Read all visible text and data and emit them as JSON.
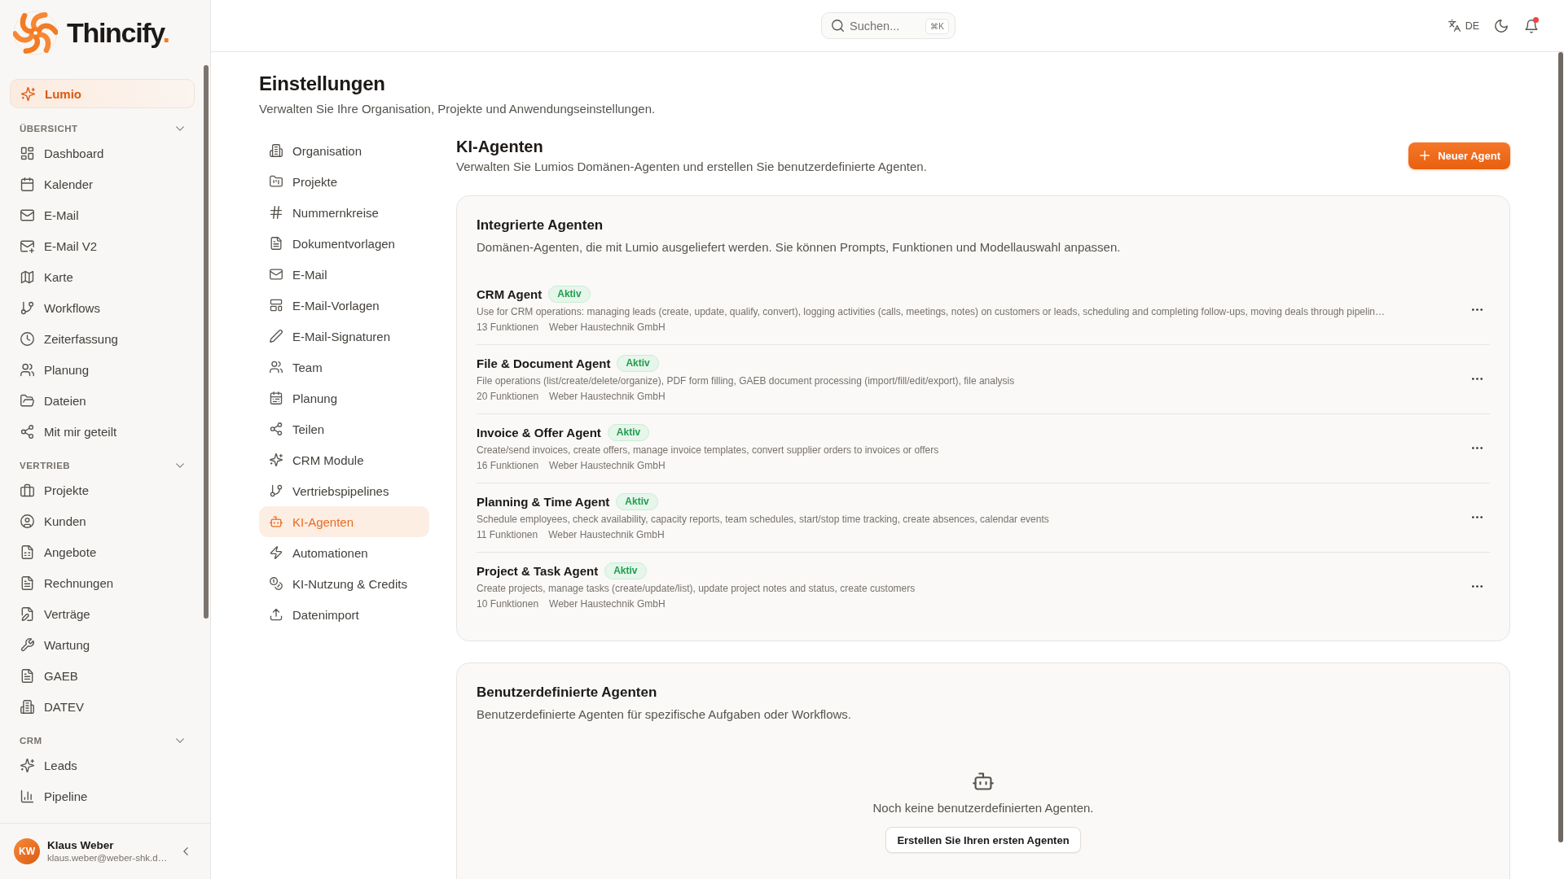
{
  "sidebar": {
    "logo": {
      "text": "Thincify",
      "accent": "."
    },
    "assistant": {
      "label": "Lumio"
    },
    "sections": [
      {
        "title": "ÜBERSICHT",
        "expanded": true,
        "items": [
          {
            "label": "Dashboard",
            "selected": false
          },
          {
            "label": "Kalender",
            "selected": false
          },
          {
            "label": "E-Mail",
            "selected": false
          },
          {
            "label": "E-Mail V2",
            "selected": false
          },
          {
            "label": "Karte",
            "selected": false
          },
          {
            "label": "Workflows",
            "selected": false
          },
          {
            "label": "Zeiterfassung",
            "selected": false
          },
          {
            "label": "Planung",
            "selected": false
          },
          {
            "label": "Dateien",
            "selected": false
          },
          {
            "label": "Mit mir geteilt",
            "selected": false
          }
        ]
      },
      {
        "title": "VERTRIEB",
        "expanded": true,
        "items": [
          {
            "label": "Projekte",
            "selected": false
          },
          {
            "label": "Kunden",
            "selected": false
          },
          {
            "label": "Angebote",
            "selected": false
          },
          {
            "label": "Rechnungen",
            "selected": false
          },
          {
            "label": "Verträge",
            "selected": false
          },
          {
            "label": "Wartung",
            "selected": false
          },
          {
            "label": "GAEB",
            "selected": false
          },
          {
            "label": "DATEV",
            "selected": false
          }
        ]
      },
      {
        "title": "CRM",
        "expanded": true,
        "items": [
          {
            "label": "Leads",
            "selected": false
          },
          {
            "label": "Pipeline",
            "selected": false
          }
        ]
      }
    ],
    "user": {
      "initials": "KW",
      "name": "Klaus Weber",
      "email": "klaus.weber@weber-shk.d…"
    }
  },
  "topbar": {
    "search": {
      "placeholder": "Suchen...",
      "shortcut": "⌘K"
    },
    "language": "DE",
    "notifications_unread": true
  },
  "page": {
    "title": "Einstellungen",
    "subtitle": "Verwalten Sie Ihre Organisation, Projekte und Anwendungseinstellungen."
  },
  "settings_nav": [
    {
      "label": "Organisation",
      "selected": false
    },
    {
      "label": "Projekte",
      "selected": false
    },
    {
      "label": "Nummernkreise",
      "selected": false
    },
    {
      "label": "Dokumentvorlagen",
      "selected": false
    },
    {
      "label": "E-Mail",
      "selected": false
    },
    {
      "label": "E-Mail-Vorlagen",
      "selected": false
    },
    {
      "label": "E-Mail-Signaturen",
      "selected": false
    },
    {
      "label": "Team",
      "selected": false
    },
    {
      "label": "Planung",
      "selected": false
    },
    {
      "label": "Teilen",
      "selected": false
    },
    {
      "label": "CRM Module",
      "selected": false
    },
    {
      "label": "Vertriebspipelines",
      "selected": false
    },
    {
      "label": "KI-Agenten",
      "selected": true
    },
    {
      "label": "Automationen",
      "selected": false
    },
    {
      "label": "KI-Nutzung & Credits",
      "selected": false
    },
    {
      "label": "Datenimport",
      "selected": false
    }
  ],
  "section": {
    "title": "KI-Agenten",
    "subtitle": "Verwalten Sie Lumios Domänen-Agenten und erstellen Sie benutzerdefinierte Agenten.",
    "action": "Neuer Agent"
  },
  "builtin_agents": {
    "title": "Integrierte Agenten",
    "description": "Domänen-Agenten, die mit Lumio ausgeliefert werden. Sie können Prompts, Funktionen und Modellauswahl anpassen.",
    "agents": [
      {
        "name": "CRM Agent",
        "status": "Aktiv",
        "description": "Use for CRM operations: managing leads (create, update, qualify, convert), logging activities (calls, meetings, notes) on customers or leads, scheduling and completing follow-ups, moving deals through pipelin…",
        "functions": "13 Funktionen",
        "owner": "Weber Haustechnik GmbH"
      },
      {
        "name": "File & Document Agent",
        "status": "Aktiv",
        "description": "File operations (list/create/delete/organize), PDF form filling, GAEB document processing (import/fill/edit/export), file analysis",
        "functions": "20 Funktionen",
        "owner": "Weber Haustechnik GmbH"
      },
      {
        "name": "Invoice & Offer Agent",
        "status": "Aktiv",
        "description": "Create/send invoices, create offers, manage invoice templates, convert supplier orders to invoices or offers",
        "functions": "16 Funktionen",
        "owner": "Weber Haustechnik GmbH"
      },
      {
        "name": "Planning & Time Agent",
        "status": "Aktiv",
        "description": "Schedule employees, check availability, capacity reports, team schedules, start/stop time tracking, create absences, calendar events",
        "functions": "11 Funktionen",
        "owner": "Weber Haustechnik GmbH"
      },
      {
        "name": "Project & Task Agent",
        "status": "Aktiv",
        "description": "Create projects, manage tasks (create/update/list), update project notes and status, create customers",
        "functions": "10 Funktionen",
        "owner": "Weber Haustechnik GmbH"
      }
    ]
  },
  "custom_agents": {
    "title": "Benutzerdefinierte Agenten",
    "description": "Benutzerdefinierte Agenten für spezifische Aufgaben oder Workflows.",
    "empty_text": "Noch keine benutzerdefinierten Agenten.",
    "create_button": "Erstellen Sie Ihren ersten Agenten"
  }
}
